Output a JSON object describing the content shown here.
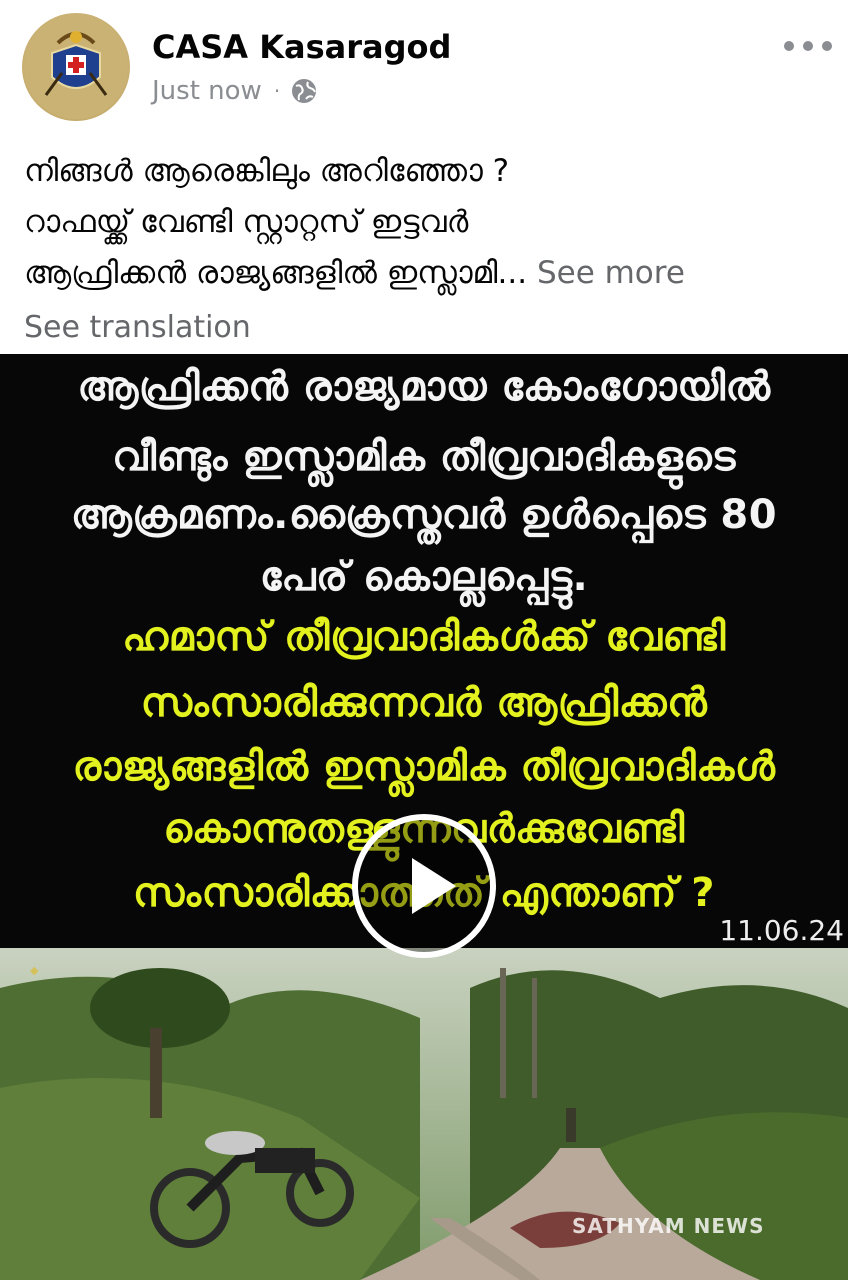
{
  "post": {
    "author": "CASA Kasaragod",
    "time": "Just now",
    "separator": "·",
    "privacy_icon": "globe-icon",
    "more_icon": "more-dots-icon",
    "avatar_label": "CASA",
    "caption_lines": [
      "നിങ്ങൾ ആരെങ്കിലും അറിഞ്ഞോ ?",
      "റാഫയ്ക്ക് വേണ്ടി സ്റ്റാറ്റസ് ഇട്ടവർ",
      "ആഫ്രിക്കൻ രാജ്യങ്ങളിൽ ഇസ്ലാമി..."
    ],
    "see_more": "See more",
    "see_translation": "See translation"
  },
  "media": {
    "banner_lines": [
      {
        "text": "ആഫ്രിക്കൻ രാജ്യമായ കോംഗോയിൽ",
        "color": "#f4f4f4"
      },
      {
        "text": "വീണ്ടും ഇസ്ലാമിക തീവ്രവാദികളുടെ",
        "color": "#f4f4f4"
      },
      {
        "text": "ആക്രമണം.ക്രൈസ്തവർ ഉൾപ്പെടെ 80",
        "color": "#f4f4f4"
      },
      {
        "text": "പേര് കൊല്ലപ്പെട്ടു.",
        "color": "#f4f4f4"
      },
      {
        "text": "ഹമാസ് തീവ്രവാദികൾക്ക് വേണ്ടി",
        "color": "#e3f11e"
      },
      {
        "text": "സംസാരിക്കുന്നവർ ആഫ്രിക്കൻ",
        "color": "#e3f11e"
      },
      {
        "text": "രാജ്യങ്ങളിൽ ഇസ്ലാമിക തീവ്രവാദികൾ",
        "color": "#e3f11e"
      },
      {
        "text": "കൊന്നുതള്ളുന്നവർക്കുവേണ്ടി",
        "color": "#e3f11e"
      },
      {
        "text": "സംസാരിക്കാത്തത് എന്താണ് ?",
        "color": "#e3f11e"
      }
    ],
    "date": "11.06.24",
    "video_watermark": "SATHYAM NEWS",
    "play_icon": "play-icon"
  }
}
